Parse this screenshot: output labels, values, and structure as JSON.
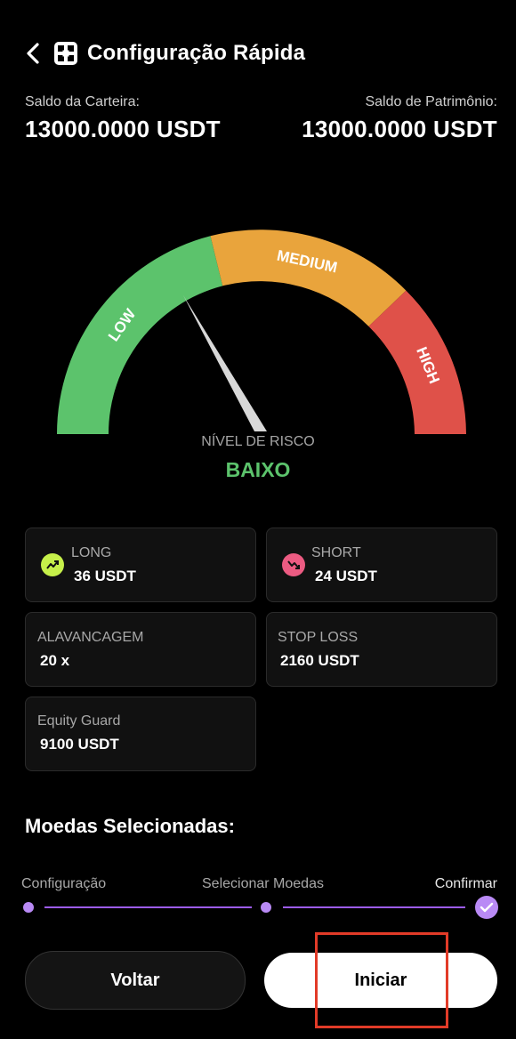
{
  "header": {
    "title": "Configuração Rápida"
  },
  "balances": {
    "wallet_label": "Saldo da Carteira:",
    "wallet_value": "13000.0000 USDT",
    "equity_label": "Saldo de Patrimônio:",
    "equity_value": "13000.0000 USDT"
  },
  "gauge": {
    "segments": [
      {
        "label": "LOW",
        "color": "#5cc36c"
      },
      {
        "label": "MEDIUM",
        "color": "#e9a43c"
      },
      {
        "label": "HIGH",
        "color": "#df5149"
      }
    ],
    "risk_label": "NÍVEL DE RISCO",
    "risk_value": "BAIXO"
  },
  "cards": {
    "long_label": "LONG",
    "long_value": "36 USDT",
    "short_label": "SHORT",
    "short_value": "24 USDT",
    "leverage_label": "ALAVANCAGEM",
    "leverage_value": "20 x",
    "stoploss_label": "STOP LOSS",
    "stoploss_value": "2160 USDT",
    "equity_guard_label": "Equity Guard",
    "equity_guard_value": "9100 USDT"
  },
  "coins": {
    "title": "Moedas Selecionadas:"
  },
  "steps": [
    {
      "label": "Configuração"
    },
    {
      "label": "Selecionar Moedas"
    },
    {
      "label": "Confirmar"
    }
  ],
  "colors": {
    "accent": "#9c5cf0",
    "low": "#5cc36c",
    "medium": "#e9a43c",
    "high": "#df5149",
    "long_icon": "#c6f04a",
    "short_icon": "#ec5b82"
  },
  "buttons": {
    "back": "Voltar",
    "start": "Iniciar"
  }
}
